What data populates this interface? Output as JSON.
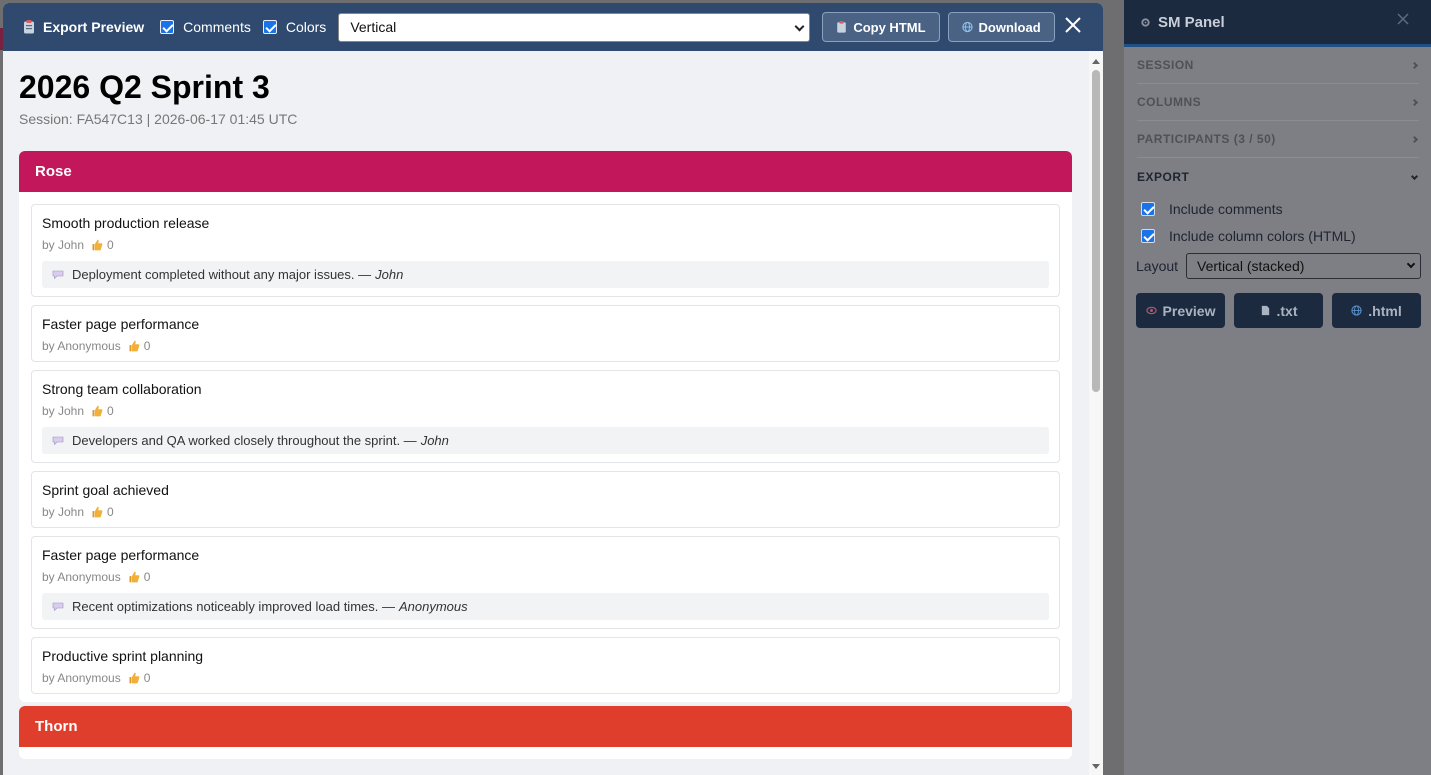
{
  "modal": {
    "title": "Export Preview",
    "options": [
      {
        "label": "Comments",
        "checked": true
      },
      {
        "label": "Colors",
        "checked": true
      }
    ],
    "layout_value": "Vertical",
    "copy_label": "Copy HTML",
    "download_label": "Download"
  },
  "document": {
    "title": "2026 Q2 Sprint 3",
    "subtitle": "Session: FA547C13  |  2026-06-17 01:45 UTC"
  },
  "sections": [
    {
      "name": "Rose",
      "color": "#c2185b",
      "items": [
        {
          "title": "Smooth production release",
          "author": "by John",
          "votes": "0",
          "comment": "Deployment completed without any major issues. —",
          "comment_author": "John"
        },
        {
          "title": "Faster page performance",
          "author": "by Anonymous",
          "votes": "0"
        },
        {
          "title": "Strong team collaboration",
          "author": "by John",
          "votes": "0",
          "comment": "Developers and QA worked closely throughout the sprint. —",
          "comment_author": "John"
        },
        {
          "title": "Sprint goal achieved",
          "author": "by John",
          "votes": "0"
        },
        {
          "title": "Faster page performance",
          "author": "by Anonymous",
          "votes": "0",
          "comment": "Recent optimizations noticeably improved load times. —",
          "comment_author": "Anonymous"
        },
        {
          "title": "Productive sprint planning",
          "author": "by Anonymous",
          "votes": "0"
        }
      ]
    },
    {
      "name": "Thorn",
      "color": "#e03e2d",
      "items": []
    }
  ],
  "panel": {
    "title": "SM Panel",
    "sections": [
      {
        "label": "SESSION",
        "open": false
      },
      {
        "label": "COLUMNS",
        "open": false
      },
      {
        "label": "PARTICIPANTS (3 / 50)",
        "open": false
      },
      {
        "label": "EXPORT",
        "open": true
      }
    ],
    "export": {
      "options": [
        {
          "label": "Include comments",
          "checked": true
        },
        {
          "label": "Include column colors (HTML)",
          "checked": true
        }
      ],
      "layout_label": "Layout",
      "layout_value": "Vertical (stacked)",
      "buttons": [
        {
          "label": "Preview",
          "icon": "eye-icon"
        },
        {
          "label": ".txt",
          "icon": "file-icon"
        },
        {
          "label": ".html",
          "icon": "globe-icon"
        }
      ]
    }
  }
}
